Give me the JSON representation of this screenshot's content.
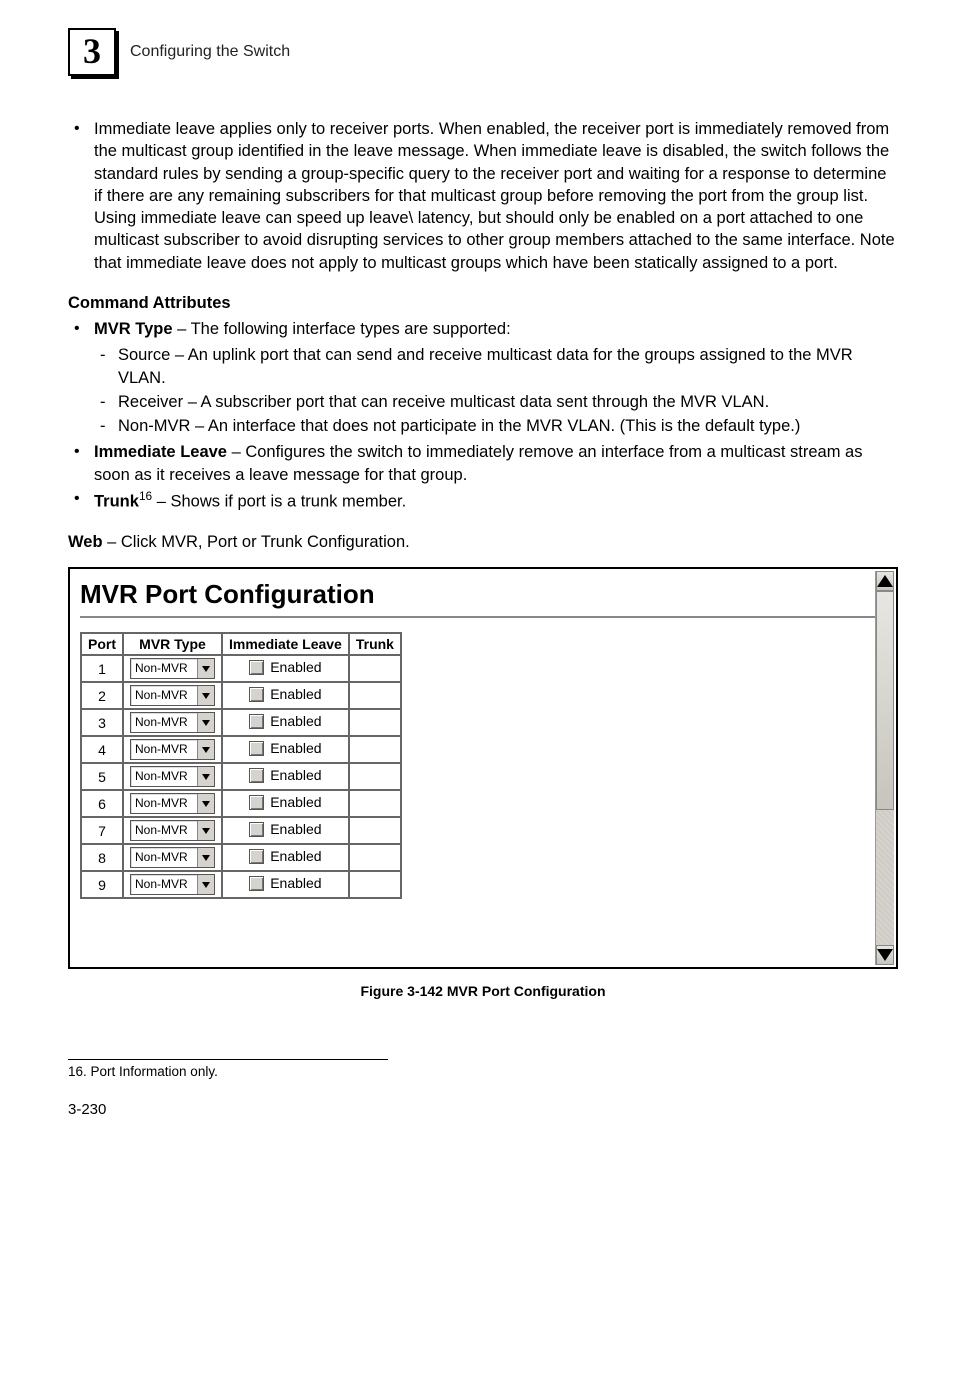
{
  "header": {
    "chapter_number": "3",
    "chapter_title": "Configuring the Switch"
  },
  "intro_bullet": "Immediate leave applies only to receiver ports. When enabled, the receiver port is immediately removed from the multicast group identified in the leave message. When immediate leave is disabled, the switch follows the standard rules by sending a group-specific query to the receiver port and waiting for a response to determine if there are any remaining subscribers for that multicast group before removing the port from the group list. Using immediate leave can speed up leave\\ latency, but should only be enabled on a port attached to one multicast subscriber to avoid disrupting services to other group members attached to the same interface. Note that immediate leave does not apply to multicast groups which have been statically assigned to a port.",
  "command_attr_heading": "Command Attributes",
  "mvr_type": {
    "label": "MVR Type",
    "desc": " – The following interface types are supported:",
    "items": [
      "Source – An uplink port that can send and receive multicast data for the groups assigned to the MVR VLAN.",
      "Receiver – A subscriber port that can receive multicast data sent through the MVR VLAN.",
      "Non-MVR – An interface that does not participate in the MVR VLAN. (This is the default type.)"
    ]
  },
  "immediate_leave": {
    "label": "Immediate Leave",
    "desc": " – Configures the switch to immediately remove an interface from a multicast stream as soon as it receives a leave message for that group."
  },
  "trunk": {
    "label": "Trunk",
    "sup": "16",
    "desc": " – Shows if port is a trunk member."
  },
  "web_line": {
    "label": "Web",
    "desc": " – Click MVR, Port or Trunk Configuration."
  },
  "screenshot": {
    "title": "MVR Port Configuration",
    "columns": [
      "Port",
      "MVR Type",
      "Immediate Leave",
      "Trunk"
    ],
    "mvrtype_option": "Non-MVR",
    "leave_label": "Enabled",
    "rows": [
      {
        "port": "1"
      },
      {
        "port": "2"
      },
      {
        "port": "3"
      },
      {
        "port": "4"
      },
      {
        "port": "5"
      },
      {
        "port": "6"
      },
      {
        "port": "7"
      },
      {
        "port": "8"
      },
      {
        "port": "9"
      }
    ]
  },
  "figure_caption": "Figure 3-142  MVR Port Configuration",
  "footnote": "16. Port Information only.",
  "page_number": "3-230"
}
